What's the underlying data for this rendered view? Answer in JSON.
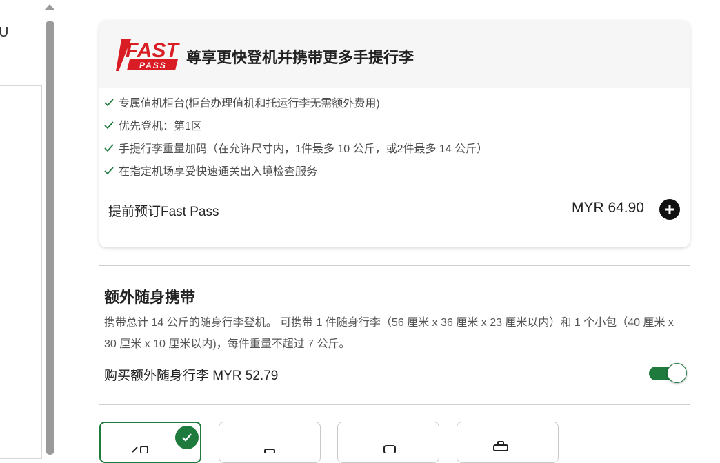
{
  "sidebar": {
    "partial_text": "U"
  },
  "fast_pass": {
    "logo_top": "FAST",
    "logo_bottom": "PASS",
    "title": "尊享更快登机并携带更多手提行李",
    "benefits": [
      "专属值机柜台(柜台办理值机和托运行李无需额外费用)",
      "优先登机：第1区",
      "手提行李重量加码（在允许尺寸内，1件最多 10 公斤，或2件最多 14 公斤）",
      "在指定机场享受快速通关出入境检查服务"
    ],
    "prebook_label": "提前预订Fast Pass",
    "price": "MYR 64.90"
  },
  "extra_carry_on": {
    "title": "额外随身携带",
    "description": "携带总计 14 公斤的随身行李登机。 可携带 1 件随身行李（56 厘米 x 36 厘米 x 23 厘米以内）和 1 个小包（40 厘米 x 30 厘米 x 10 厘米以内)，每件重量不超过 7 公斤。",
    "buy_label": "购买额外随身行李 MYR 52.79",
    "toggle_on": true
  },
  "colors": {
    "accent_green": "#1f7a3e",
    "logo_red": "#d81e24"
  }
}
